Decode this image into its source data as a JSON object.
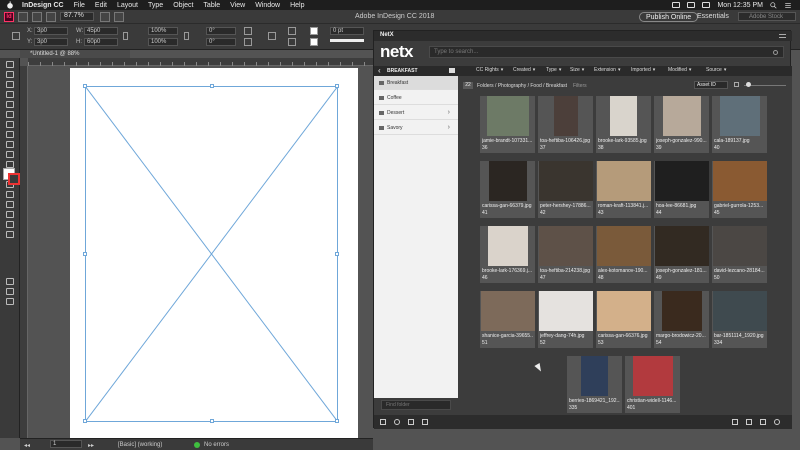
{
  "menubar": {
    "app_name": "InDesign CC",
    "items": [
      "File",
      "Edit",
      "Layout",
      "Type",
      "Object",
      "Table",
      "View",
      "Window",
      "Help"
    ],
    "clock": "Mon 12:35 PM"
  },
  "appbar": {
    "zoom": "87.7%",
    "title": "Adobe InDesign CC 2018",
    "publish_label": "Publish Online",
    "workspace_label": "Essentials",
    "help_search_placeholder": "Adobe Stock"
  },
  "controlbar": {
    "x_label": "X:",
    "x_value": "3p0",
    "y_label": "Y:",
    "y_value": "3p0",
    "w_label": "W:",
    "w_value": "45p0",
    "h_label": "H:",
    "h_value": "60p0",
    "scale_x": "100%",
    "scale_y": "100%",
    "rotate": "0°",
    "shear": "0°",
    "stroke_weight": "0 pt"
  },
  "document": {
    "tab_label": "*Untitled-1 @ 88%",
    "page_number": "1",
    "style_label": "[Basic] (working)",
    "preflight_label": "No errors"
  },
  "netx": {
    "panel_tab": "NetX",
    "logo": "netx",
    "search_placeholder": "Type to search...",
    "sidebar_title": "BREAKFAST",
    "folders": [
      {
        "label": "Breakfast",
        "active": true,
        "has_children": false
      },
      {
        "label": "Coffee",
        "active": false,
        "has_children": false
      },
      {
        "label": "Dessert",
        "active": false,
        "has_children": true
      },
      {
        "label": "Savory",
        "active": false,
        "has_children": true
      }
    ],
    "find_folder_placeholder": "Find folder",
    "filters": [
      "CC Rights",
      "Created",
      "Type",
      "Size",
      "Extension",
      "Imported",
      "Modified",
      "Source"
    ],
    "asset_count": "22",
    "breadcrumb": "Folders / Photography / Food / Breakfast",
    "filters_link": "Filters",
    "sort_label": "Asset ID",
    "assets": [
      {
        "file": "jamie-brandt-107331...",
        "id": "36",
        "w": 42,
        "h": 40,
        "color": "#6d7a66"
      },
      {
        "file": "toa-heftiba-106426.jpg",
        "id": "37",
        "w": 24,
        "h": 40,
        "color": "#4c3f3a"
      },
      {
        "file": "brooke-lark-93585.jpg",
        "id": "38",
        "w": 27,
        "h": 40,
        "color": "#d9d4cc"
      },
      {
        "file": "joseph-gonzalez-990...",
        "id": "39",
        "w": 38,
        "h": 40,
        "color": "#b7a99a"
      },
      {
        "file": "cala-189137.jpg",
        "id": "40",
        "w": 40,
        "h": 40,
        "color": "#5f6f79"
      },
      {
        "file": "carissa-gan-66379.jpg",
        "id": "41",
        "w": 38,
        "h": 40,
        "color": "#2b2622"
      },
      {
        "file": "peter-hershey-17886...",
        "id": "42",
        "w": 54,
        "h": 40,
        "color": "#3a352f"
      },
      {
        "file": "roman-kraft-113841.j...",
        "id": "43",
        "w": 54,
        "h": 40,
        "color": "#b59b7a"
      },
      {
        "file": "hoa-lee-86681.jpg",
        "id": "44",
        "w": 54,
        "h": 40,
        "color": "#1f1f1f"
      },
      {
        "file": "gabriel-gurrola-1253...",
        "id": "45",
        "w": 54,
        "h": 40,
        "color": "#8a5a32"
      },
      {
        "file": "brooke-lark-176369.j...",
        "id": "46",
        "w": 40,
        "h": 40,
        "color": "#dad3cb"
      },
      {
        "file": "toa-heftiba-214238.jpg",
        "id": "47",
        "w": 54,
        "h": 40,
        "color": "#5e5148"
      },
      {
        "file": "alex-kotomanov-190...",
        "id": "48",
        "w": 54,
        "h": 40,
        "color": "#7a5a3a"
      },
      {
        "file": "joseph-gonzalez-181...",
        "id": "49",
        "w": 54,
        "h": 40,
        "color": "#322a22"
      },
      {
        "file": "david-lezcano-28184...",
        "id": "50",
        "w": 54,
        "h": 40,
        "color": "#4b4744"
      },
      {
        "file": "shanice-garcia-39655...",
        "id": "51",
        "w": 54,
        "h": 40,
        "color": "#7d6a5a"
      },
      {
        "file": "jeffrey-dang-74h.jpg",
        "id": "52",
        "w": 54,
        "h": 40,
        "color": "#e5e2df"
      },
      {
        "file": "carissa-gan-66376.jpg",
        "id": "53",
        "w": 54,
        "h": 40,
        "color": "#d3b08a"
      },
      {
        "file": "margo-brodowicz-20...",
        "id": "54",
        "w": 40,
        "h": 40,
        "color": "#3a2a1e"
      },
      {
        "file": "bar-1851114_1920.jpg",
        "id": "334",
        "w": 54,
        "h": 40,
        "color": "#3f4a4f"
      },
      {
        "file": "berries-1869421_192...",
        "id": "335",
        "w": 27,
        "h": 40,
        "color": "#2f3f5a"
      },
      {
        "file": "christian-widell-1146...",
        "id": "401",
        "w": 40,
        "h": 40,
        "color": "#b23a3e"
      }
    ]
  },
  "colors": {
    "frame_blue": "#6fa7d9",
    "panel_bg": "#3c3c3c",
    "sidebar_bg": "#f2f2f2",
    "status_green": "#3fbf3f"
  }
}
